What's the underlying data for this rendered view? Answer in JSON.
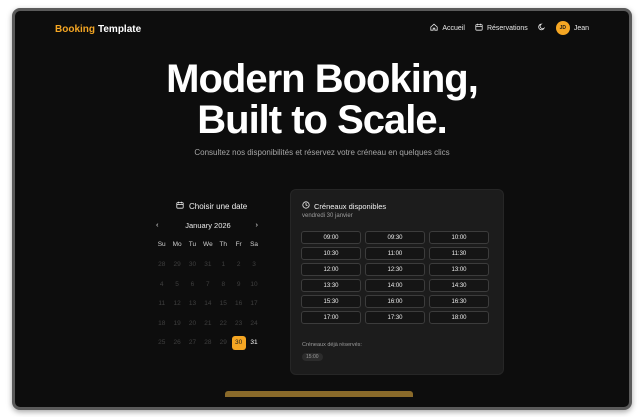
{
  "nav": {
    "brand_part1": "Booking",
    "brand_part2": "Template",
    "links": [
      {
        "label": "Accueil",
        "icon": "home-icon"
      },
      {
        "label": "Réservations",
        "icon": "calendar-icon"
      }
    ],
    "theme_icon": "moon-icon",
    "user": {
      "initials": "JD",
      "name": "Jean"
    }
  },
  "hero": {
    "line1": "Modern Booking,",
    "line2": "Built to Scale.",
    "subtitle": "Consultez nos disponibilités et réservez votre créneau en quelques clics"
  },
  "calendar": {
    "heading": "Choisir une date",
    "month": "January 2026",
    "prev": "‹",
    "next": "›",
    "weekdays": [
      "Su",
      "Mo",
      "Tu",
      "We",
      "Th",
      "Fr",
      "Sa"
    ],
    "days": [
      "28",
      "29",
      "30",
      "31",
      "1",
      "2",
      "3",
      "4",
      "5",
      "6",
      "7",
      "8",
      "9",
      "10",
      "11",
      "12",
      "13",
      "14",
      "15",
      "16",
      "17",
      "18",
      "19",
      "20",
      "21",
      "22",
      "23",
      "24",
      "25",
      "26",
      "27",
      "28",
      "29",
      "30",
      "31"
    ],
    "selected": "30",
    "available": [
      "30",
      "31"
    ]
  },
  "slots": {
    "title": "Créneaux disponibles",
    "date": "vendredi 30 janvier",
    "times": [
      "09:00",
      "09:30",
      "10:00",
      "10:30",
      "11:00",
      "11:30",
      "12:00",
      "12:30",
      "13:00",
      "13:30",
      "14:00",
      "14:30",
      "15:30",
      "16:00",
      "16:30",
      "17:00",
      "17:30",
      "18:00"
    ],
    "booked_label": "Créneaux déjà réservés:",
    "booked": [
      "15:00"
    ]
  },
  "colors": {
    "accent": "#f5a623",
    "background": "#0d0d0d",
    "panel": "#1c1c1c"
  }
}
